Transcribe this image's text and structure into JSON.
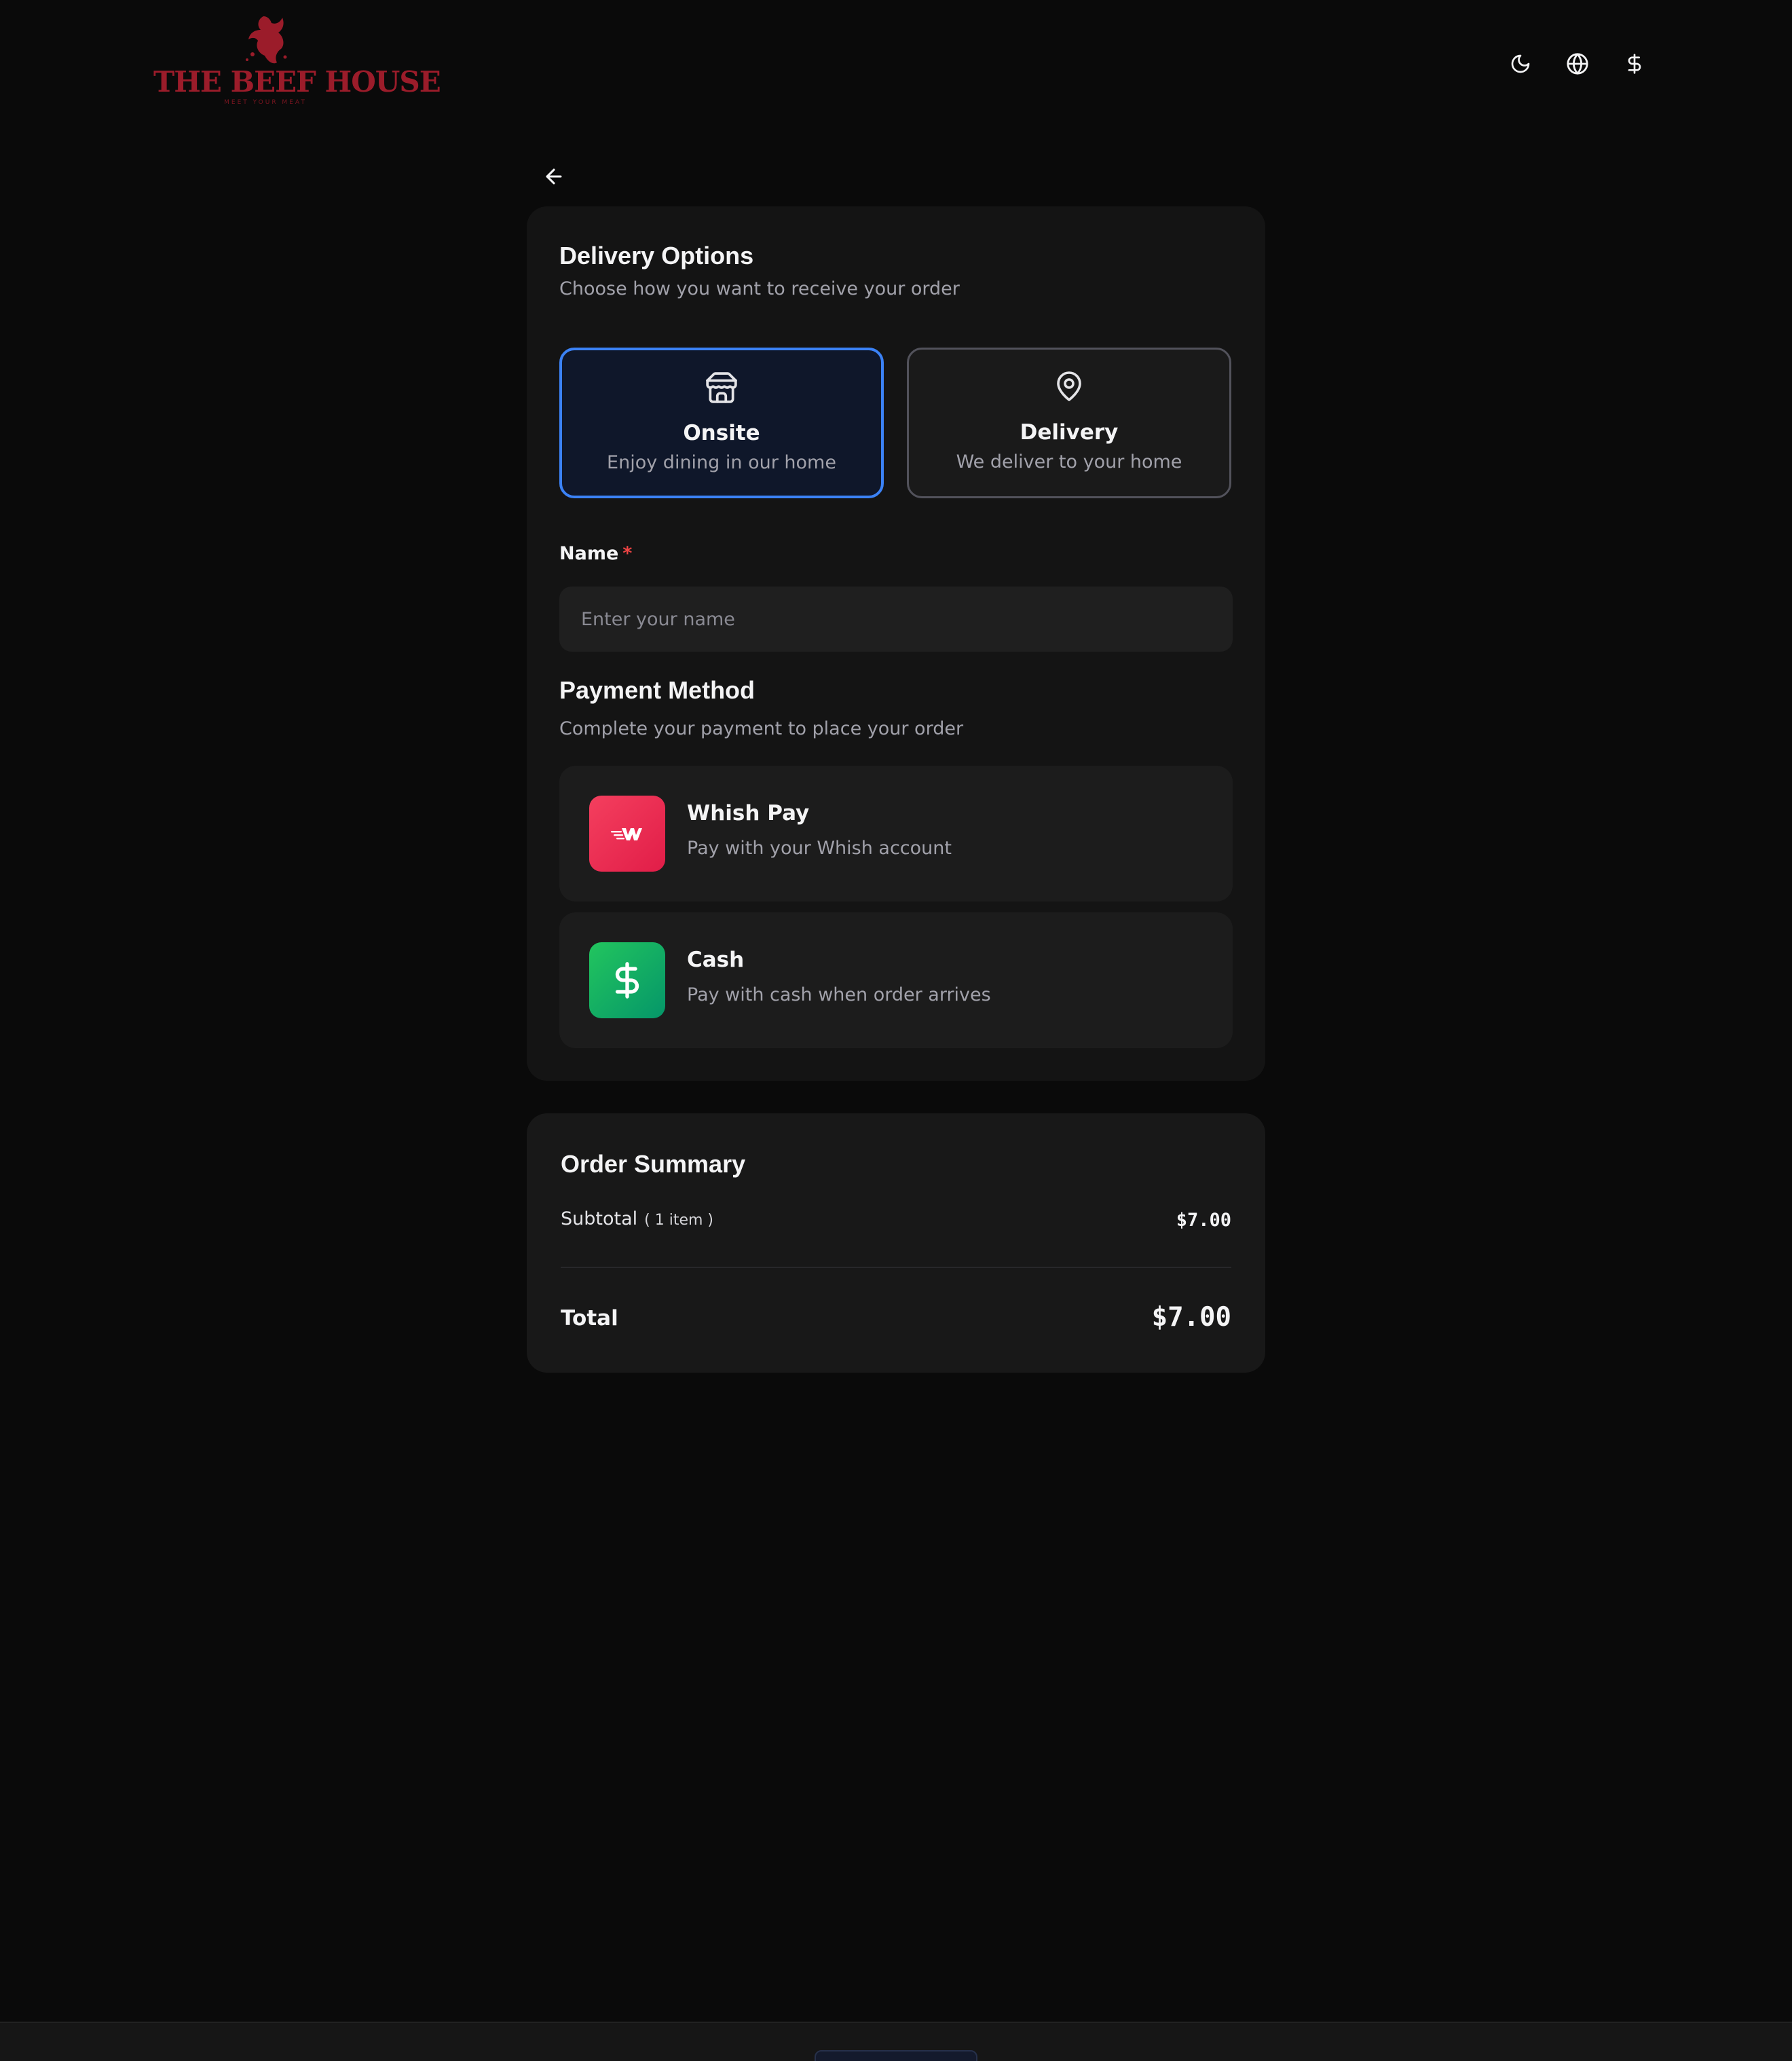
{
  "brand": {
    "name": "THE BEEF HOUSE",
    "tagline": "MEET YOUR MEAT",
    "color": "#9b1c2a"
  },
  "header": {
    "icons": [
      "moon-icon",
      "globe-icon",
      "dollar-icon"
    ]
  },
  "delivery": {
    "title": "Delivery Options",
    "subtitle": "Choose how you want to receive your order",
    "options": [
      {
        "title": "Onsite",
        "description": "Enjoy dining in our home",
        "icon": "store-icon",
        "selected": true
      },
      {
        "title": "Delivery",
        "description": "We deliver to your home",
        "icon": "map-pin-icon",
        "selected": false
      }
    ]
  },
  "form": {
    "name_label": "Name",
    "required_mark": "*",
    "name_placeholder": "Enter your name",
    "name_value": ""
  },
  "payment": {
    "title": "Payment Method",
    "subtitle": "Complete your payment to place your order",
    "methods": [
      {
        "title": "Whish Pay",
        "description": "Pay with your Whish account",
        "icon": "whish-icon",
        "color": "#e11d48"
      },
      {
        "title": "Cash",
        "description": "Pay with cash when order arrives",
        "icon": "dollar-icon",
        "color": "#16a34a"
      }
    ]
  },
  "summary": {
    "title": "Order Summary",
    "subtotal_label": "Subtotal",
    "item_count": "( 1 item )",
    "subtotal_value": "$7.00",
    "total_label": "Total",
    "total_value": "$7.00"
  },
  "colors": {
    "accent": "#3b82f6",
    "background": "#0a0a0a",
    "card": "#141414"
  }
}
